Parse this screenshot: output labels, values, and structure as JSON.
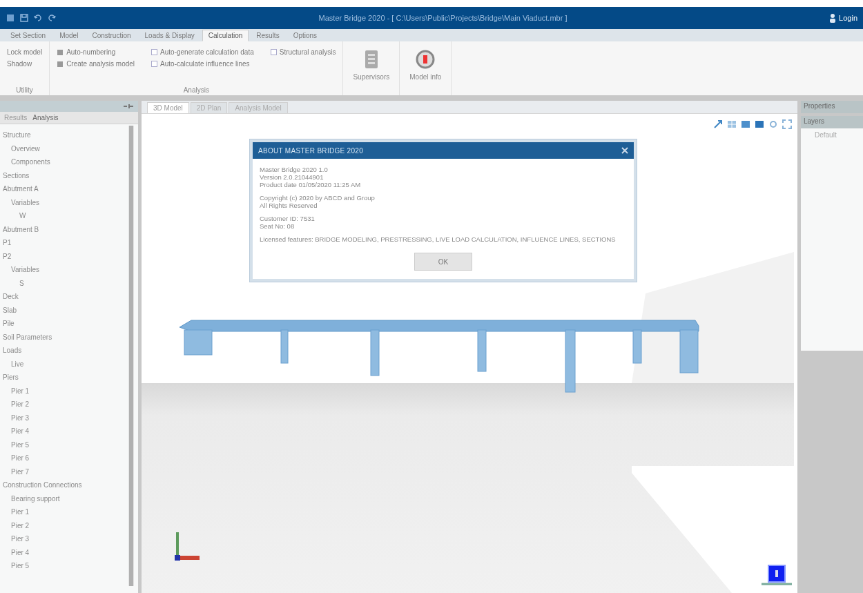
{
  "window": {
    "title": "Master Bridge 2020 - [ C:\\Users\\Public\\Projects\\Bridge\\Main Viaduct.mbr ]",
    "user": "Login"
  },
  "ribbon": {
    "tabs": [
      {
        "label": "Set Section",
        "selected": false
      },
      {
        "label": "Model",
        "selected": false
      },
      {
        "label": "Construction",
        "selected": false
      },
      {
        "label": "Loads & Display",
        "selected": false
      },
      {
        "label": "Calculation",
        "selected": true
      },
      {
        "label": "Results",
        "selected": false
      },
      {
        "label": "Options",
        "selected": false
      }
    ],
    "groups": [
      {
        "kind": "options",
        "label": "Utility",
        "columns": [
          [
            {
              "kind": "text",
              "label": "Lock model"
            },
            {
              "kind": "text",
              "label": "Shadow"
            }
          ]
        ]
      },
      {
        "kind": "options",
        "label": "Analysis",
        "columns": [
          [
            {
              "kind": "icon",
              "label": "Auto-numbering"
            },
            {
              "kind": "icon",
              "label": "Create analysis model"
            }
          ],
          [
            {
              "kind": "check",
              "label": "Auto-generate calculation data",
              "checked": false
            },
            {
              "kind": "check",
              "label": "Auto-calculate influence lines",
              "checked": false
            }
          ],
          [
            {
              "kind": "check",
              "label": "Structural analysis",
              "checked": false
            }
          ]
        ]
      },
      {
        "kind": "document",
        "label": "Supervisors"
      },
      {
        "kind": "record",
        "label": "Model info"
      }
    ]
  },
  "left_panel": {
    "tabs": [
      {
        "label": "Results",
        "selected": false
      },
      {
        "label": "Analysis",
        "selected": true
      }
    ],
    "tree": [
      {
        "label": "Structure",
        "children": [
          {
            "label": "Overview"
          },
          {
            "label": "Components"
          }
        ]
      },
      {
        "label": "Sections"
      },
      {
        "label": "Abutment A",
        "children": [
          {
            "label": "Variables",
            "children": [
              {
                "label": "W"
              }
            ]
          }
        ]
      },
      {
        "label": "Abutment B"
      },
      {
        "label": "P1"
      },
      {
        "label": "P2",
        "children": [
          {
            "label": "Variables",
            "children": [
              {
                "label": "S"
              }
            ]
          }
        ]
      },
      {
        "label": "Deck"
      },
      {
        "label": "Slab"
      },
      {
        "label": "Pile"
      },
      {
        "label": "Soil Parameters"
      },
      {
        "label": "Loads",
        "children": [
          {
            "label": "Live"
          }
        ]
      },
      {
        "label": "Piers",
        "children": [
          {
            "label": "Pier 1"
          },
          {
            "label": "Pier 2"
          },
          {
            "label": "Pier 3"
          },
          {
            "label": "Pier 4"
          },
          {
            "label": "Pier 5"
          },
          {
            "label": "Pier 6"
          },
          {
            "label": "Pier 7"
          }
        ]
      },
      {
        "label": "Construction Connections",
        "children": [
          {
            "label": "Bearing support"
          },
          {
            "label": "Pier 1"
          },
          {
            "label": "Pier 2"
          },
          {
            "label": "Pier 3"
          },
          {
            "label": "Pier 4"
          },
          {
            "label": "Pier 5"
          }
        ]
      }
    ]
  },
  "viewport": {
    "tabs": [
      {
        "label": "3D Model",
        "selected": true
      },
      {
        "label": "2D Plan",
        "selected": false
      },
      {
        "label": "Analysis Model",
        "selected": false
      }
    ]
  },
  "dialog": {
    "title": "ABOUT MASTER BRIDGE 2020",
    "paragraphs": [
      [
        "Master Bridge 2020 1.0",
        "Version 2.0.21044901",
        "Product date 01/05/2020 11:25 AM"
      ],
      [
        "Copyright (c) 2020 by ABCD and Group",
        "All Rights Reserved"
      ],
      [
        "Customer ID: 7531",
        "Seat No: 08"
      ],
      [
        "Licensed features: BRIDGE MODELING, PRESTRESSING, LIVE LOAD CALCULATION, INFLUENCE LINES, SECTIONS"
      ]
    ],
    "button": "OK"
  },
  "right_panels": [
    {
      "title": "Properties"
    },
    {
      "title": "Layers",
      "items": [
        "Default"
      ]
    }
  ]
}
